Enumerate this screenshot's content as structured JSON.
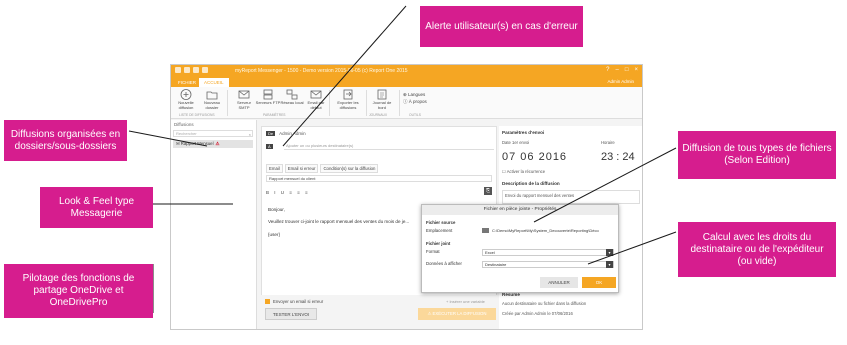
{
  "callouts": {
    "alert": "Alerte utilisateur(s) en cas d'erreur",
    "folders": "Diffusions organisées en dossiers/sous-dossiers",
    "look": "Look & Feel type Messagerie",
    "onedrive": "Pilotage des fonctions de partage OneDrive et OneDrivePro",
    "files": "Diffusion de tous types de fichiers (Selon Edition)",
    "rights": "Calcul avec les droits du destinataire ou de l'expéditeur (ou vide)"
  },
  "app": {
    "title": "myReport Messenger - 1500 - Demo version 2015-06-05 (c) Report One 2015",
    "tabs": [
      "FICHIER",
      "ACCUEIL"
    ],
    "active_tab": "ACCUEIL",
    "user": "Admin Admin",
    "ribbon": {
      "buttons": [
        {
          "label": "Nouvelle diffusion",
          "icon": "plus-circle-icon"
        },
        {
          "label": "Nouveau dossier",
          "icon": "folder-icon"
        },
        {
          "label": "Serveur SMTP",
          "icon": "mail-server-icon"
        },
        {
          "label": "Serveurs FTP",
          "icon": "ftp-server-icon"
        },
        {
          "label": "Réseau local",
          "icon": "network-icon"
        },
        {
          "label": "Email par défaut",
          "icon": "default-mail-icon"
        },
        {
          "label": "Exporter les diffusions",
          "icon": "export-icon"
        },
        {
          "label": "Journal de bord",
          "icon": "journal-icon"
        }
      ],
      "groups": [
        "LISTE DE DIFFUSIONS",
        "PARAMÈTRES",
        "JOURNAUX",
        "OUTILS"
      ],
      "language": "Langues",
      "about": "À propos"
    }
  },
  "left": {
    "title": "Diffusions",
    "search_placeholder": "Rechercher",
    "item": "Rapport Mensuel"
  },
  "editor": {
    "de_badge": "De",
    "from": "Admin Admin",
    "a_badge": "À",
    "to_placeholder": "Ajouter un ou plusieurs destinataire(s)",
    "subtabs": [
      "Email",
      "Email si erreur",
      "Condition(s) sur la diffusion"
    ],
    "subject": "Rapport mensuel du client",
    "toolbar": "B  I  U  ≡  ≡  ≡",
    "body": [
      "Bonjour,",
      "Veuillez trouver ci-joint le rapport mensuel des ventes du mois de je...",
      "{user}"
    ],
    "alert_check": "Envoyer un email si erreur",
    "insert_link": "+ Insérer une variable",
    "test_button": "TESTER L'ENVOI",
    "exec_button": "EXÉCUTER LA DIFFUSION"
  },
  "right": {
    "params_title": "Paramètres d'envoi",
    "date_label": "Date 1er envoi",
    "hour_label": "Horaire",
    "date_value": "07  06  2016",
    "time_value": "23 : 24",
    "recurrence": "Activer la récurrence",
    "desc_title": "Description de la diffusion",
    "desc_text": "Envoi du rapport mensuel des ventes",
    "summary_title": "Résumé",
    "summary_text": "Aucun destinataire ou fichier dans la diffusion",
    "created": "Créée par Admin Admin le 07/06/2016"
  },
  "dialog": {
    "title": "Fichier en pièce jointe - Propriétés",
    "source_title": "Fichier source",
    "location_label": "Emplacement",
    "location_value": "C:\\Demo\\MyReport\\My\\System_Decouverte\\Reporting\\Déco",
    "joined_title": "Fichier joint",
    "format_label": "Format",
    "format_value": "Excel",
    "data_label": "Données à afficher",
    "data_value": "Destinataire",
    "cancel": "ANNULER",
    "ok": "OK"
  }
}
